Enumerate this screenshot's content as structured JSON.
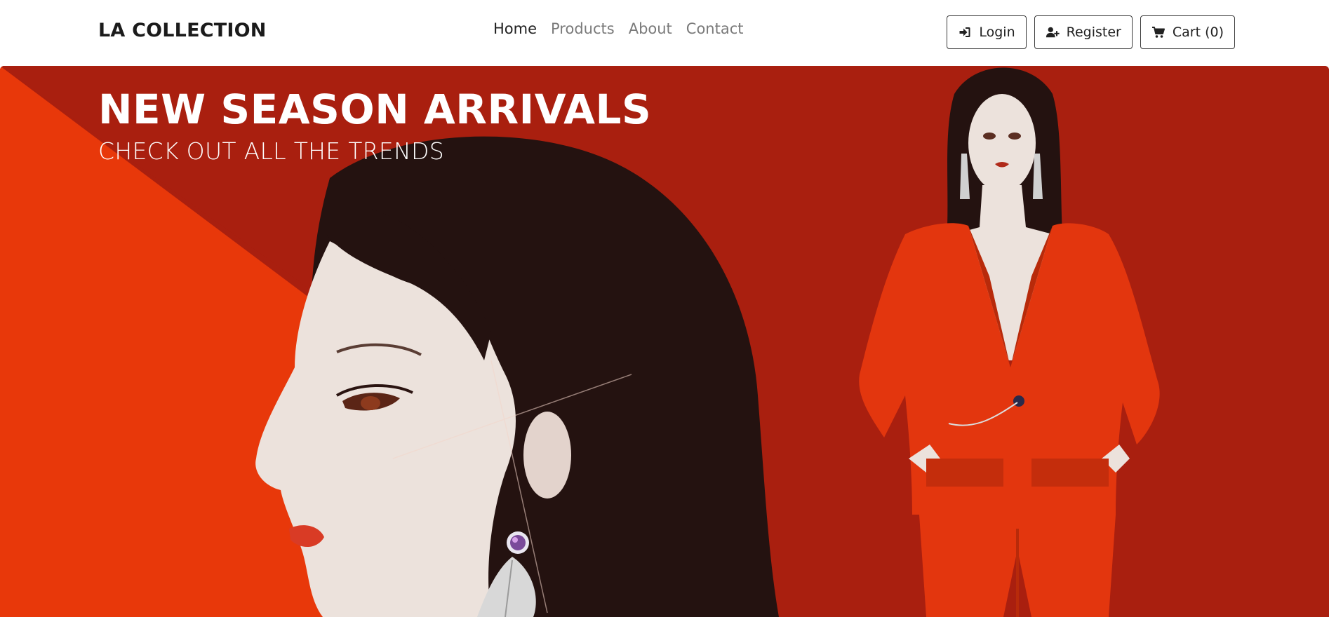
{
  "brand": {
    "name": "LA COLLECTION"
  },
  "nav": {
    "links": [
      {
        "label": "Home",
        "active": true
      },
      {
        "label": "Products",
        "active": false
      },
      {
        "label": "About",
        "active": false
      },
      {
        "label": "Contact",
        "active": false
      }
    ]
  },
  "actions": {
    "login": {
      "label": "Login",
      "icon": "sign-in-icon"
    },
    "register": {
      "label": "Register",
      "icon": "user-plus-icon"
    },
    "cart": {
      "label": "Cart (0)",
      "icon": "cart-icon"
    }
  },
  "hero": {
    "title": "NEW SEASON ARRIVALS",
    "subtitle": "CHECK OUT ALL THE TRENDS",
    "colors": {
      "background": "#a91f0f",
      "accent_triangle": "#e8380a",
      "hair": "#241210",
      "skin": "#ece2dc",
      "suit": "#e3360e"
    }
  }
}
